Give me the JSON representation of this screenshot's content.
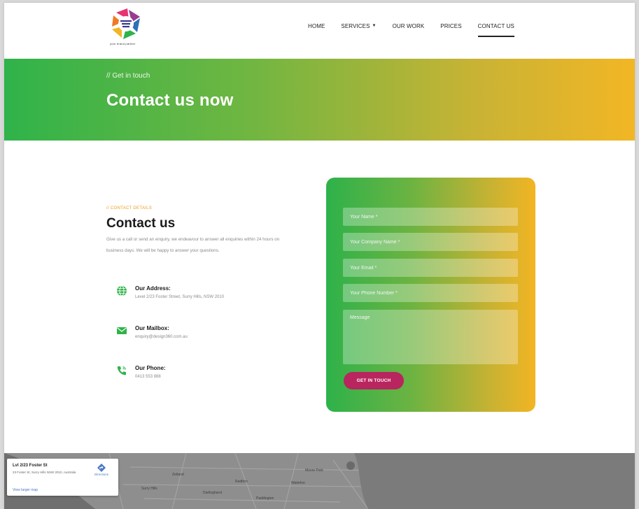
{
  "header": {
    "logo_tagline": "your brand partner",
    "nav": [
      {
        "label": "HOME",
        "has_caret": false,
        "active": false
      },
      {
        "label": "SERVICES",
        "has_caret": true,
        "active": false
      },
      {
        "label": "OUR WORK",
        "has_caret": false,
        "active": false
      },
      {
        "label": "PRICES",
        "has_caret": false,
        "active": false
      },
      {
        "label": "CONTACT US",
        "has_caret": false,
        "active": true
      }
    ]
  },
  "hero": {
    "eyebrow": "// Get in touch",
    "title": "Contact us now"
  },
  "contact": {
    "eyebrow": "// CONTACT DETAILS",
    "heading": "Contact us",
    "intro": "Give us a call or send an enquiry, we endeavour to answer all enquiries within 24 hours on business days. We will be happy to answer your questions.",
    "items": [
      {
        "icon": "globe-icon",
        "title": "Our Address:",
        "text": "Level 2/23 Foster Street, Surry Hills, NSW 2010"
      },
      {
        "icon": "mail-icon",
        "title": "Our Mailbox:",
        "text": "enquiry@design360.com.au"
      },
      {
        "icon": "phone-icon",
        "title": "Our Phone:",
        "text": "0413 553 888"
      }
    ]
  },
  "form": {
    "name_placeholder": "Your Name *",
    "company_placeholder": "Your Company Name *",
    "email_placeholder": "Your Email *",
    "phone_placeholder": "Your Phone Number *",
    "message_placeholder": "Message",
    "submit_label": "GET IN TOUCH"
  },
  "map": {
    "card_title": "Lvl 2/23 Foster St",
    "card_address": "23 Foster St, Surry Hills NSW 2010, Australia",
    "card_link": "View larger map",
    "directions_label": "Directions",
    "labels": [
      "Surry Hills",
      "Darlinghurst",
      "Redfern",
      "Paddington",
      "Waterloo",
      "Moore Park",
      "Zetland"
    ]
  },
  "colors": {
    "gradient_start": "#2fb34a",
    "gradient_end": "#f2b625",
    "accent_orange": "#f29b1e",
    "button_magenta": "#b8255f"
  }
}
